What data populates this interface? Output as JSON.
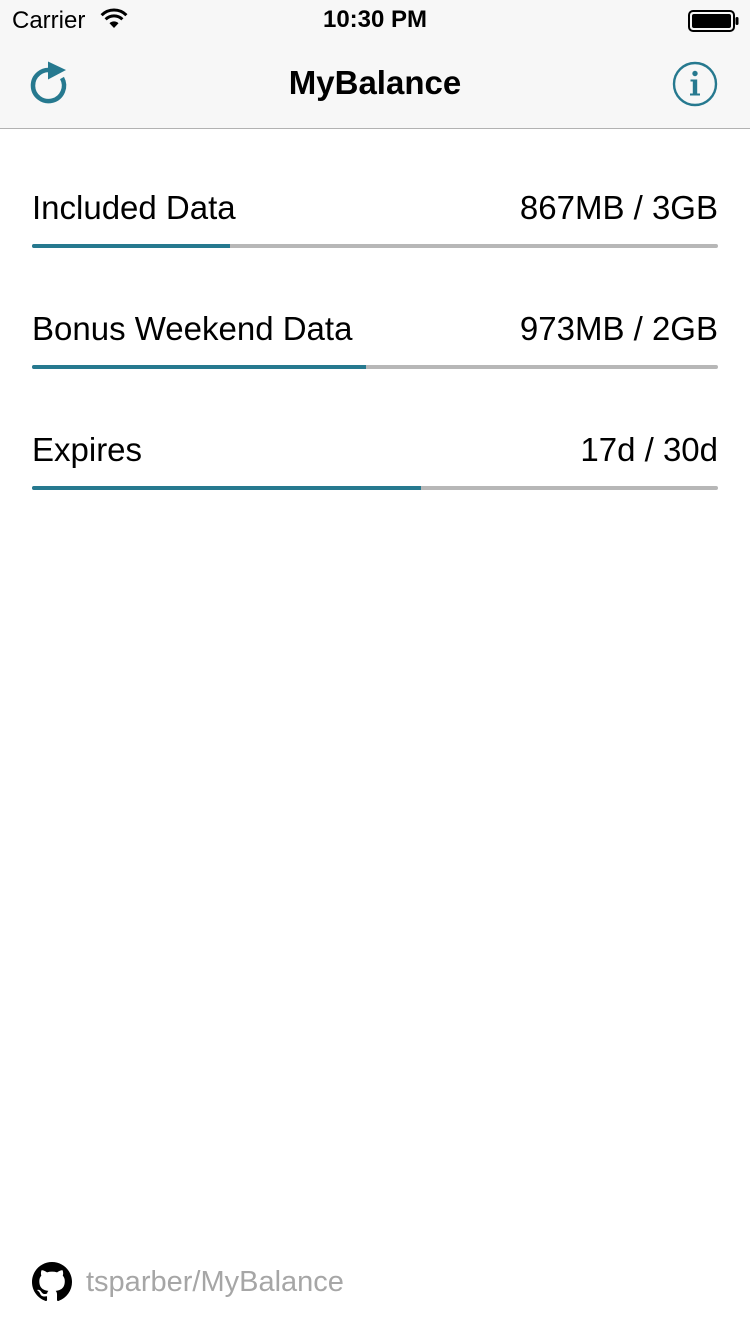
{
  "status_bar": {
    "carrier": "Carrier",
    "time": "10:30 PM",
    "wifi_icon": "wifi-icon",
    "battery_icon": "battery-full-icon"
  },
  "nav": {
    "title": "MyBalance",
    "left_icon": "refresh-icon",
    "right_icon": "info-icon",
    "accent_color": "#26798f"
  },
  "balances": [
    {
      "label": "Included Data",
      "value": "867MB / 3GB",
      "progress": 0.289
    },
    {
      "label": "Bonus Weekend Data",
      "value": "973MB / 2GB",
      "progress": 0.487
    },
    {
      "label": "Expires",
      "value": "17d / 30d",
      "progress": 0.567
    }
  ],
  "footer": {
    "icon": "github-icon",
    "link_text": "tsparber/MyBalance",
    "link_color": "#a6a6a6"
  },
  "colors": {
    "progress_fill": "#26798f",
    "progress_track": "#b7b7b7",
    "navbar_background": "#f7f7f7"
  }
}
